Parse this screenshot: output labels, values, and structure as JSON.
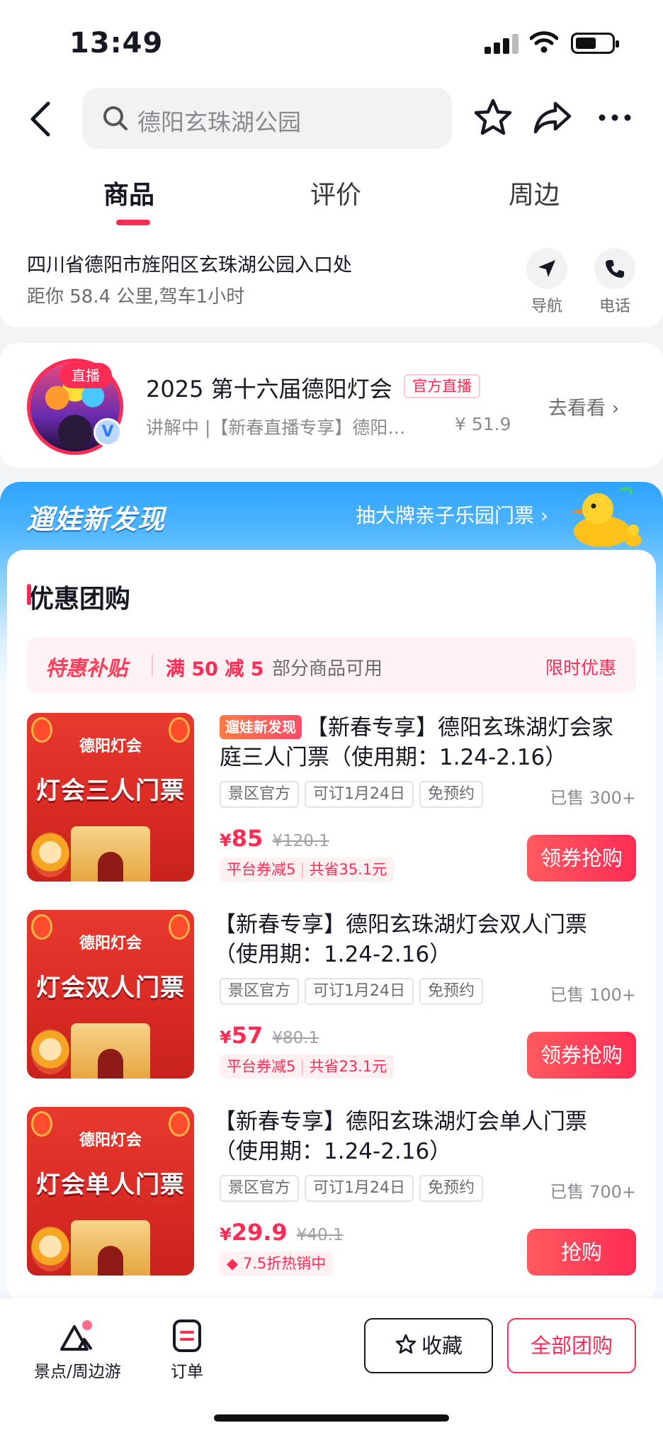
{
  "status_bar": {
    "time": "13:49"
  },
  "header": {
    "search_text": "德阳玄珠湖公园",
    "tabs": [
      {
        "label": "商品",
        "active": true
      },
      {
        "label": "评价",
        "active": false
      },
      {
        "label": "周边",
        "active": false
      }
    ],
    "icons": [
      "back-icon",
      "search-icon",
      "star-icon",
      "share-icon",
      "more-icon"
    ]
  },
  "address": {
    "line": "四川省德阳市旌阳区玄珠湖公园入口处",
    "distance": "距你 58.4 公里,驾车1小时",
    "nav_label": "导航",
    "phone_label": "电话"
  },
  "live": {
    "tag": "直播",
    "title": "2025 第十六届德阳灯会",
    "official_tag": "官方直播",
    "subtitle": "讲解中 |【新春直播专享】德阳…",
    "price": "¥ 51.9",
    "go_label": "去看看",
    "verified_glyph": "V"
  },
  "promo": {
    "brand": "遛娃新发现",
    "link_label": "抽大牌亲子乐园门票"
  },
  "group": {
    "title": "优惠团购",
    "subsidy": {
      "label": "特惠补贴",
      "deal": "满 50 减 5",
      "note": "部分商品可用",
      "limit": "限时优惠"
    },
    "items": [
      {
        "thumb_logo": "德阳灯会",
        "thumb_title": "灯会三人门票",
        "new_tag": "遛娃新发现",
        "title": "【新春专享】德阳玄珠湖灯会家庭三人门票（使用期：1.24-2.16）",
        "chips": [
          "景区官方",
          "可订1月24日",
          "免预约"
        ],
        "sold": "已售 300+",
        "currency": "¥",
        "price": "85",
        "old_price": "¥120.1",
        "perk1": "平台券减5",
        "perk2": "共省35.1元",
        "button": "领券抢购"
      },
      {
        "thumb_logo": "德阳灯会",
        "thumb_title": "灯会双人门票",
        "new_tag": "",
        "title": "【新春专享】德阳玄珠湖灯会双人门票（使用期：1.24-2.16）",
        "chips": [
          "景区官方",
          "可订1月24日",
          "免预约"
        ],
        "sold": "已售 100+",
        "currency": "¥",
        "price": "57",
        "old_price": "¥80.1",
        "perk1": "平台券减5",
        "perk2": "共省23.1元",
        "button": "领券抢购"
      },
      {
        "thumb_logo": "德阳灯会",
        "thumb_title": "灯会单人门票",
        "new_tag": "",
        "title": "【新春专享】德阳玄珠湖灯会单人门票（使用期：1.24-2.16）",
        "chips": [
          "景区官方",
          "可订1月24日",
          "免预约"
        ],
        "sold": "已售 700+",
        "currency": "¥",
        "price": "29.9",
        "old_price": "¥40.1",
        "perk1": "7.5折热销中",
        "perk2": "",
        "button": "抢购"
      }
    ]
  },
  "bottom_bar": {
    "nav1": "景点/周边游",
    "nav2": "订单",
    "favorite": "收藏",
    "all_groups": "全部团购"
  },
  "colors": {
    "accent": "#fe2c55",
    "promo_blue": "#2fa3ff"
  }
}
